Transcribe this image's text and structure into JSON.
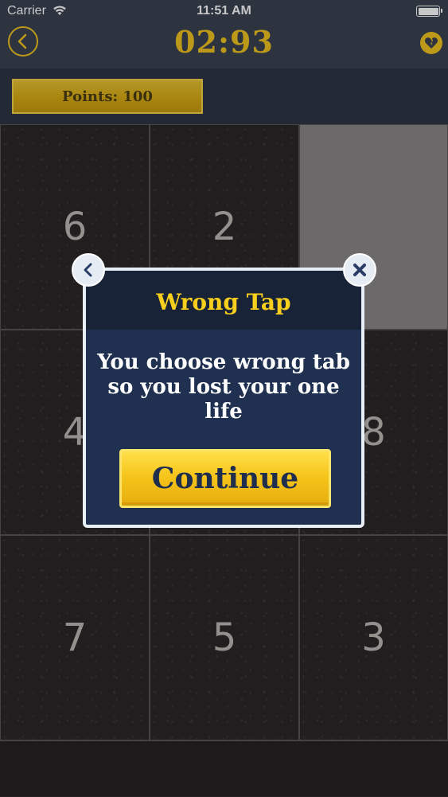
{
  "status_bar": {
    "carrier": "Carrier",
    "time": "11:51 AM"
  },
  "navbar": {
    "timer": "02:93",
    "back_icon": "chevron-left-icon",
    "heart_icon": "broken-heart-icon"
  },
  "points": {
    "label": "Points: 100"
  },
  "board": {
    "tiles": [
      "6",
      "2",
      "",
      "4",
      "",
      "8",
      "7",
      "5",
      "3"
    ],
    "revealed_index": 2
  },
  "dialog": {
    "title": "Wrong Tap",
    "message": "You choose wrong tab so you lost your one life",
    "continue_label": "Continue",
    "back_icon": "chevron-left-icon",
    "close_icon": "close-icon"
  },
  "colors": {
    "accent": "#f2c521",
    "bar": "#3a4353",
    "dialog": "#203050"
  }
}
